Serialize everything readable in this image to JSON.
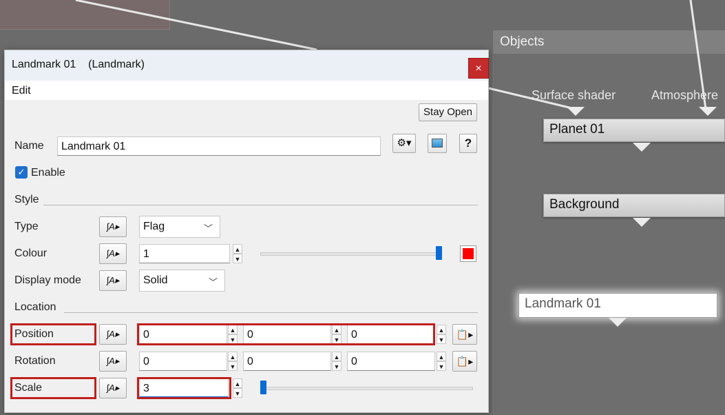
{
  "graph": {
    "objects_title": "Objects",
    "ports": [
      "Surface shader",
      "Atmosphere"
    ],
    "nodes": [
      "Planet 01",
      "Background",
      "Landmark 01"
    ]
  },
  "dialog": {
    "title": "Landmark 01    (Landmark)",
    "close_icon": "×",
    "menu": {
      "edit_label": "Edit"
    },
    "stay_open_label": "Stay Open",
    "name_label": "Name",
    "name_value": "Landmark 01",
    "enable_label": "Enable",
    "enable_checked": true,
    "style_section": "Style",
    "type_label": "Type",
    "type_value": "Flag",
    "colour_label": "Colour",
    "colour_value": "1",
    "colour_slider_fraction": 1.0,
    "colour_swatch": "#ff0000",
    "display_mode_label": "Display mode",
    "display_mode_value": "Solid",
    "location_section": "Location",
    "position_label": "Position",
    "position_values": [
      "0",
      "0",
      "0"
    ],
    "rotation_label": "Rotation",
    "rotation_values": [
      "0",
      "0",
      "0"
    ],
    "scale_label": "Scale",
    "scale_value": "3",
    "scale_slider_fraction": 0.0,
    "help_label": "?",
    "icons": {
      "settings": "gear-icon",
      "preview": "preview-icon",
      "animation": "animation-curve-icon",
      "paste": "paste-icon"
    },
    "anim_glyph": "∫A▸",
    "paste_glyph": "📋▸",
    "gear_glyph": "⚙▾"
  },
  "colors": {
    "highlight": "#c0201e",
    "accent": "#0a6bd6"
  }
}
